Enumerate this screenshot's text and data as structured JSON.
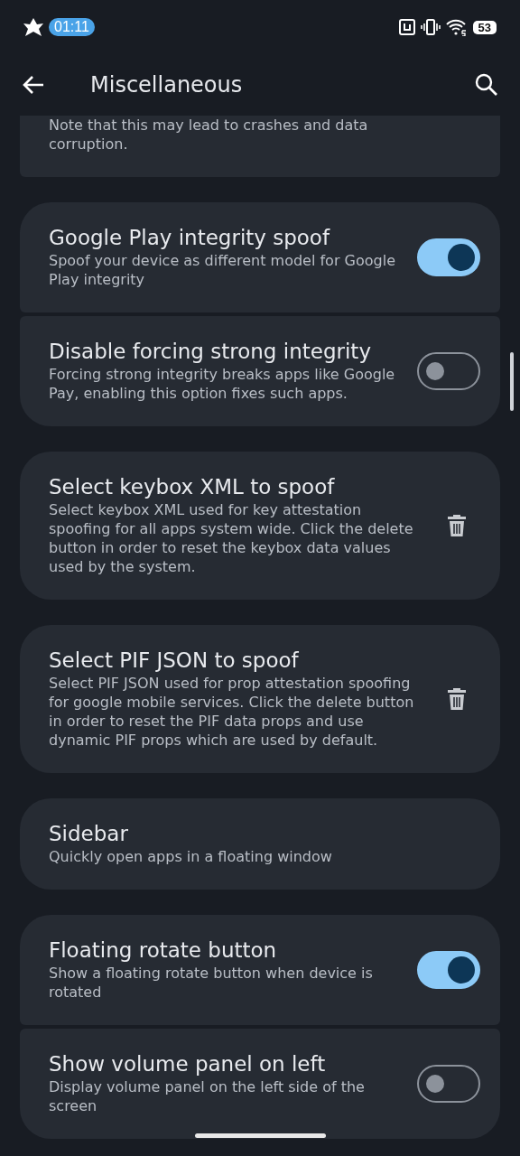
{
  "status_bar": {
    "time": "01:11",
    "battery": "53"
  },
  "app_bar": {
    "title": "Miscellaneous"
  },
  "groups": [
    {
      "items": [
        {
          "kind": "partial",
          "subtitle": "Note that this may lead to crashes and data corruption."
        }
      ]
    },
    {
      "items": [
        {
          "kind": "toggle",
          "title": "Google Play integrity spoof",
          "subtitle": "Spoof your device as different model for Google Play integrity",
          "on": true
        },
        {
          "kind": "toggle",
          "title": "Disable forcing strong integrity",
          "subtitle": "Forcing strong integrity breaks apps like Google Pay, enabling this option fixes such apps.",
          "on": false
        }
      ]
    },
    {
      "items": [
        {
          "kind": "delete",
          "title": "Select keybox XML to spoof",
          "subtitle": "Select keybox XML used for key attestation spoofing for all apps system wide. Click the delete button in order to reset the keybox data values used by the system."
        }
      ]
    },
    {
      "items": [
        {
          "kind": "delete",
          "title": "Select PIF JSON to spoof",
          "subtitle": "Select PIF JSON used for prop attestation spoofing for google mobile services. Click the delete button in order to reset the PIF data props and use dynamic PIF props which are used by default."
        }
      ]
    },
    {
      "items": [
        {
          "kind": "plain",
          "title": "Sidebar",
          "subtitle": "Quickly open apps in a floating window"
        }
      ]
    },
    {
      "items": [
        {
          "kind": "toggle",
          "title": "Floating rotate button",
          "subtitle": "Show a floating rotate button when device is rotated",
          "on": true
        },
        {
          "kind": "toggle",
          "title": "Show volume panel on left",
          "subtitle": "Display volume panel on the left side of the screen",
          "on": false
        }
      ]
    }
  ]
}
